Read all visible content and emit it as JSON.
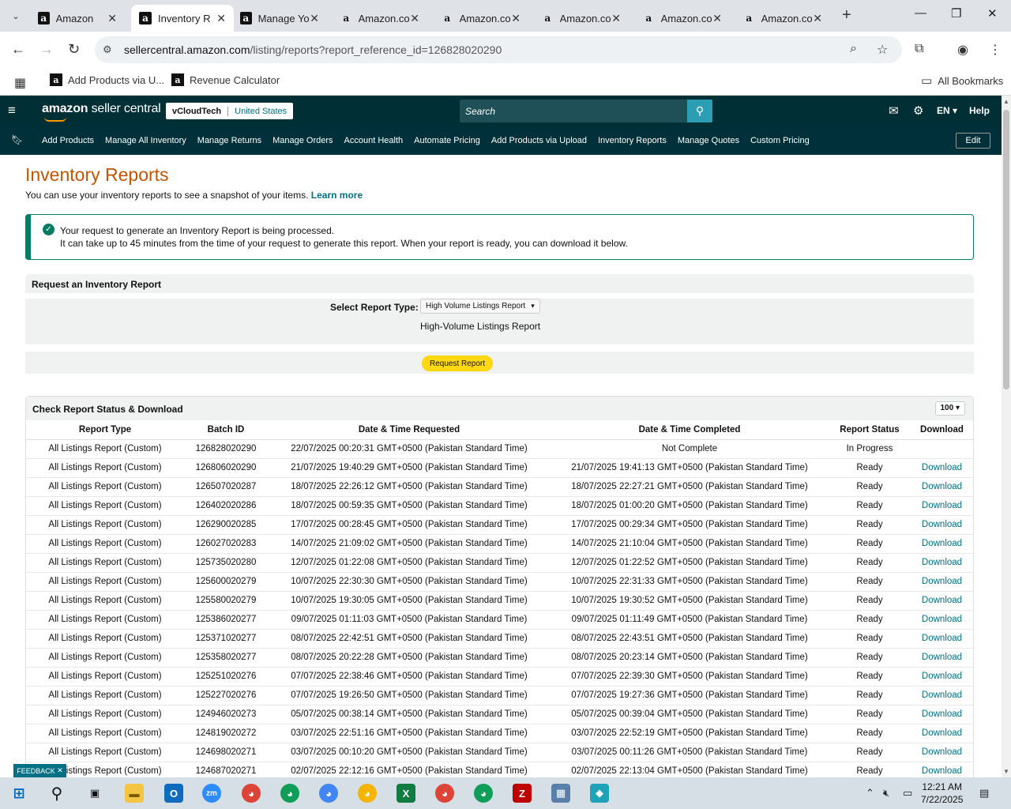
{
  "browser": {
    "tabs": [
      {
        "title": "Amazon",
        "fav": "a"
      },
      {
        "title": "Inventory R",
        "fav": "a"
      },
      {
        "title": "Manage Yo",
        "fav": "a"
      },
      {
        "title": "Amazon.co",
        "fav": "a"
      },
      {
        "title": "Amazon.co",
        "fav": "a"
      },
      {
        "title": "Amazon.co",
        "fav": "a"
      },
      {
        "title": "Amazon.co",
        "fav": "a"
      },
      {
        "title": "Amazon.co",
        "fav": "a"
      }
    ],
    "url_domain": "sellercentral.amazon.com",
    "url_path": "/listing/reports?report_reference_id=126828020290",
    "bookmarks": [
      "Add Products via U...",
      "Revenue Calculator"
    ],
    "all_bookmarks": "All Bookmarks"
  },
  "header": {
    "logo_bold": "amazon",
    "logo_rest": " seller central",
    "account_name": "vCloudTech",
    "marketplace": "United States",
    "search_placeholder": "Search",
    "lang": "EN",
    "help": "Help"
  },
  "nav": {
    "links": [
      "Add Products",
      "Manage All Inventory",
      "Manage Returns",
      "Manage Orders",
      "Account Health",
      "Automate Pricing",
      "Add Products via Upload",
      "Inventory Reports",
      "Manage Quotes",
      "Custom Pricing"
    ],
    "edit": "Edit"
  },
  "page": {
    "title": "Inventory Reports",
    "subtitle": "You can use your inventory reports to see a snapshot of your items.",
    "learn_more": "Learn more",
    "alert_line1": "Your request to generate an Inventory Report is being processed.",
    "alert_line2": "It can take up to 45 minutes from the time of your request to generate this report. When your report is ready, you can download it below."
  },
  "request": {
    "heading": "Request an Inventory Report",
    "label": "Select Report Type:",
    "selected": "High Volume Listings Report",
    "description": "High-Volume Listings Report",
    "button": "Request Report"
  },
  "status": {
    "heading": "Check Report Status & Download",
    "page_size": "100",
    "columns": [
      "Report Type",
      "Batch ID",
      "Date & Time Requested",
      "Date & Time Completed",
      "Report Status",
      "Download"
    ],
    "rows": [
      [
        "All Listings Report (Custom)",
        "126828020290",
        "22/07/2025 00:20:31 GMT+0500 (Pakistan Standard Time)",
        "Not Complete",
        "In Progress",
        ""
      ],
      [
        "All Listings Report (Custom)",
        "126806020290",
        "21/07/2025 19:40:29 GMT+0500 (Pakistan Standard Time)",
        "21/07/2025 19:41:13 GMT+0500 (Pakistan Standard Time)",
        "Ready",
        "Download"
      ],
      [
        "All Listings Report (Custom)",
        "126507020287",
        "18/07/2025 22:26:12 GMT+0500 (Pakistan Standard Time)",
        "18/07/2025 22:27:21 GMT+0500 (Pakistan Standard Time)",
        "Ready",
        "Download"
      ],
      [
        "All Listings Report (Custom)",
        "126402020286",
        "18/07/2025 00:59:35 GMT+0500 (Pakistan Standard Time)",
        "18/07/2025 01:00:20 GMT+0500 (Pakistan Standard Time)",
        "Ready",
        "Download"
      ],
      [
        "All Listings Report (Custom)",
        "126290020285",
        "17/07/2025 00:28:45 GMT+0500 (Pakistan Standard Time)",
        "17/07/2025 00:29:34 GMT+0500 (Pakistan Standard Time)",
        "Ready",
        "Download"
      ],
      [
        "All Listings Report (Custom)",
        "126027020283",
        "14/07/2025 21:09:02 GMT+0500 (Pakistan Standard Time)",
        "14/07/2025 21:10:04 GMT+0500 (Pakistan Standard Time)",
        "Ready",
        "Download"
      ],
      [
        "All Listings Report (Custom)",
        "125735020280",
        "12/07/2025 01:22:08 GMT+0500 (Pakistan Standard Time)",
        "12/07/2025 01:22:52 GMT+0500 (Pakistan Standard Time)",
        "Ready",
        "Download"
      ],
      [
        "All Listings Report (Custom)",
        "125600020279",
        "10/07/2025 22:30:30 GMT+0500 (Pakistan Standard Time)",
        "10/07/2025 22:31:33 GMT+0500 (Pakistan Standard Time)",
        "Ready",
        "Download"
      ],
      [
        "All Listings Report (Custom)",
        "125580020279",
        "10/07/2025 19:30:05 GMT+0500 (Pakistan Standard Time)",
        "10/07/2025 19:30:52 GMT+0500 (Pakistan Standard Time)",
        "Ready",
        "Download"
      ],
      [
        "All Listings Report (Custom)",
        "125386020277",
        "09/07/2025 01:11:03 GMT+0500 (Pakistan Standard Time)",
        "09/07/2025 01:11:49 GMT+0500 (Pakistan Standard Time)",
        "Ready",
        "Download"
      ],
      [
        "All Listings Report (Custom)",
        "125371020277",
        "08/07/2025 22:42:51 GMT+0500 (Pakistan Standard Time)",
        "08/07/2025 22:43:51 GMT+0500 (Pakistan Standard Time)",
        "Ready",
        "Download"
      ],
      [
        "All Listings Report (Custom)",
        "125358020277",
        "08/07/2025 20:22:28 GMT+0500 (Pakistan Standard Time)",
        "08/07/2025 20:23:14 GMT+0500 (Pakistan Standard Time)",
        "Ready",
        "Download"
      ],
      [
        "All Listings Report (Custom)",
        "125251020276",
        "07/07/2025 22:38:46 GMT+0500 (Pakistan Standard Time)",
        "07/07/2025 22:39:30 GMT+0500 (Pakistan Standard Time)",
        "Ready",
        "Download"
      ],
      [
        "All Listings Report (Custom)",
        "125227020276",
        "07/07/2025 19:26:50 GMT+0500 (Pakistan Standard Time)",
        "07/07/2025 19:27:36 GMT+0500 (Pakistan Standard Time)",
        "Ready",
        "Download"
      ],
      [
        "All Listings Report (Custom)",
        "124946020273",
        "05/07/2025 00:38:14 GMT+0500 (Pakistan Standard Time)",
        "05/07/2025 00:39:04 GMT+0500 (Pakistan Standard Time)",
        "Ready",
        "Download"
      ],
      [
        "All Listings Report (Custom)",
        "124819020272",
        "03/07/2025 22:51:16 GMT+0500 (Pakistan Standard Time)",
        "03/07/2025 22:52:19 GMT+0500 (Pakistan Standard Time)",
        "Ready",
        "Download"
      ],
      [
        "All Listings Report (Custom)",
        "124698020271",
        "03/07/2025 00:10:20 GMT+0500 (Pakistan Standard Time)",
        "03/07/2025 00:11:26 GMT+0500 (Pakistan Standard Time)",
        "Ready",
        "Download"
      ],
      [
        "All Listings Report (Custom)",
        "124687020271",
        "02/07/2025 22:12:16 GMT+0500 (Pakistan Standard Time)",
        "02/07/2025 22:13:04 GMT+0500 (Pakistan Standard Time)",
        "Ready",
        "Download"
      ]
    ]
  },
  "feedback": "FEEDBACK",
  "taskbar": {
    "time": "12:21 AM",
    "date": "7/22/2025"
  },
  "colors": {
    "header_bg": "#002f36",
    "title_orange": "#c45500",
    "link_teal": "#007185",
    "success_green": "#067d62",
    "button_yellow": "#ffd814"
  }
}
